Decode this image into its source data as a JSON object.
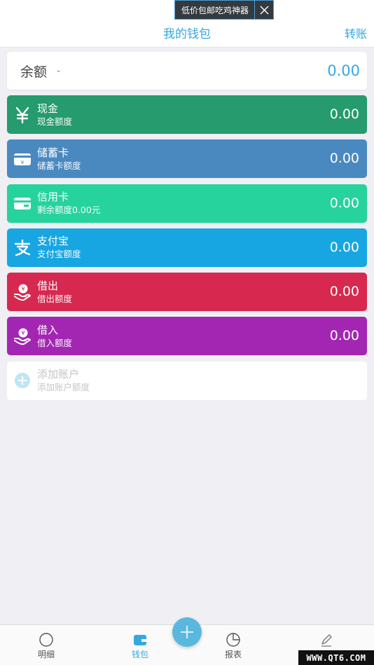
{
  "ad": {
    "text": "低价包邮吃鸡神器"
  },
  "header": {
    "title": "我的钱包",
    "action": "转账"
  },
  "balance": {
    "label": "余额",
    "caret": "⌄",
    "amount": "0.00"
  },
  "accounts": [
    {
      "name": "现金",
      "sub": "现金额度",
      "amount": "0.00",
      "color": "#259b6e",
      "icon": "yen-icon"
    },
    {
      "name": "储蓄卡",
      "sub": "储蓄卡额度",
      "amount": "0.00",
      "color": "#4a89c0",
      "icon": "debit-card-icon"
    },
    {
      "name": "信用卡",
      "sub": "剩余额度0.00元",
      "amount": "0.00",
      "color": "#26d39d",
      "icon": "credit-card-icon"
    },
    {
      "name": "支付宝",
      "sub": "支付宝额度",
      "amount": "0.00",
      "color": "#17a6e2",
      "icon": "alipay-icon"
    },
    {
      "name": "借出",
      "sub": "借出额度",
      "amount": "0.00",
      "color": "#d7284f",
      "icon": "lend-icon"
    },
    {
      "name": "借入",
      "sub": "借入额度",
      "amount": "0.00",
      "color": "#a326b3",
      "icon": "borrow-icon"
    }
  ],
  "add_account": {
    "name": "添加账户",
    "sub": "添加账户额度"
  },
  "nav": {
    "items": [
      {
        "label": "明细",
        "icon": "circle-icon"
      },
      {
        "label": "钱包",
        "icon": "wallet-icon"
      },
      {
        "label": "报表",
        "icon": "pie-chart-icon"
      },
      {
        "label": "",
        "icon": "pen-icon"
      }
    ],
    "active_color": "#36a8e0"
  },
  "watermark": "WWW.QT6.COM"
}
